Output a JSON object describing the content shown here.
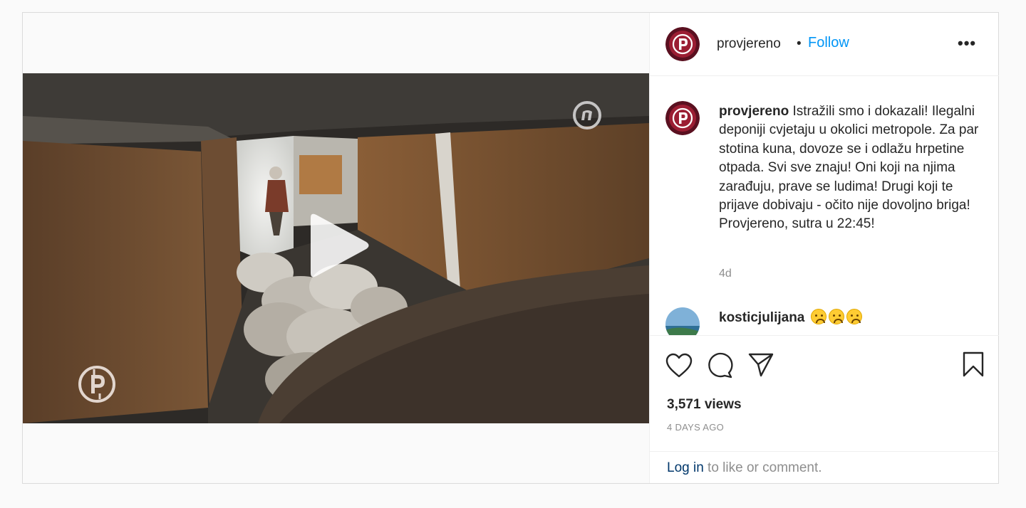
{
  "post": {
    "author": "provjereno",
    "header_dot": "•",
    "follow_label": "Follow",
    "more_label": "•••",
    "caption": {
      "username": "provjereno",
      "text": "Istražili smo i dokazali! Ilegalni deponiji cvjetaju u okolici metropole. Za par stotina kuna, dovoze se i odlažu hrpetine otpada. Svi sve znaju! Oni koji na njima zarađuju, prave se ludima! Drugi koji te prijave dobivaju - očito nije dovoljno briga! Provjereno, sutra u 22:45!",
      "time": "4d"
    },
    "comments": [
      {
        "username": "kosticjulijana",
        "emoji_count": 3
      }
    ],
    "views": "3,571 views",
    "posted_ago": "4 DAYS AGO",
    "login_link": "Log in",
    "login_rest": " to like or comment."
  },
  "colors": {
    "follow": "#0095f6",
    "avatar_red": "#8b1a2b",
    "link": "#00376b",
    "muted": "#8e8e8e"
  },
  "icons": [
    "play-icon",
    "heart-icon",
    "comment-icon",
    "share-icon",
    "bookmark-icon",
    "more-options-icon"
  ]
}
